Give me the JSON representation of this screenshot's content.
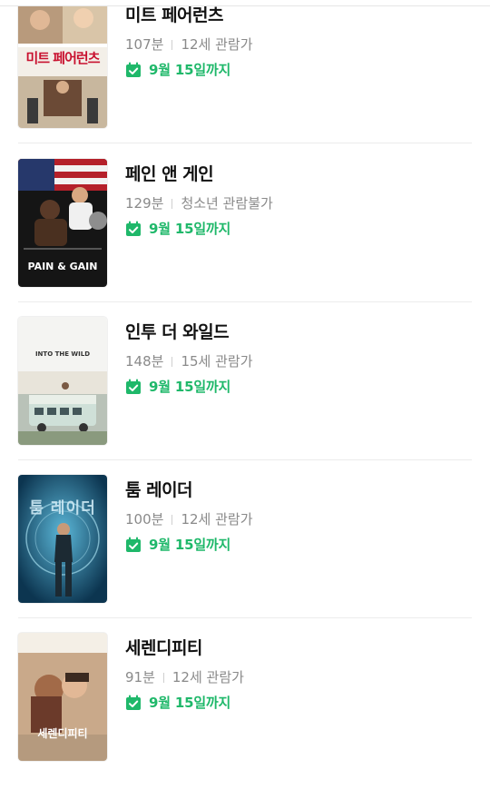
{
  "accent_color": "#1fb86a",
  "movies": [
    {
      "title": "미트 페어런츠",
      "runtime": "107분",
      "rating": "12세 관람가",
      "available_until": "9월 15일까지",
      "poster_text": "미트 페어런츠"
    },
    {
      "title": "페인 앤 게인",
      "runtime": "129분",
      "rating": "청소년 관람불가",
      "available_until": "9월 15일까지",
      "poster_text": "PAIN & GAIN"
    },
    {
      "title": "인투 더 와일드",
      "runtime": "148분",
      "rating": "15세 관람가",
      "available_until": "9월 15일까지",
      "poster_text": "INTO THE WILD"
    },
    {
      "title": "툼 레이더",
      "runtime": "100분",
      "rating": "12세 관람가",
      "available_until": "9월 15일까지",
      "poster_text": "툼 레이더"
    },
    {
      "title": "세렌디피티",
      "runtime": "91분",
      "rating": "12세 관람가",
      "available_until": "9월 15일까지",
      "poster_text": "세렌디피티"
    }
  ]
}
